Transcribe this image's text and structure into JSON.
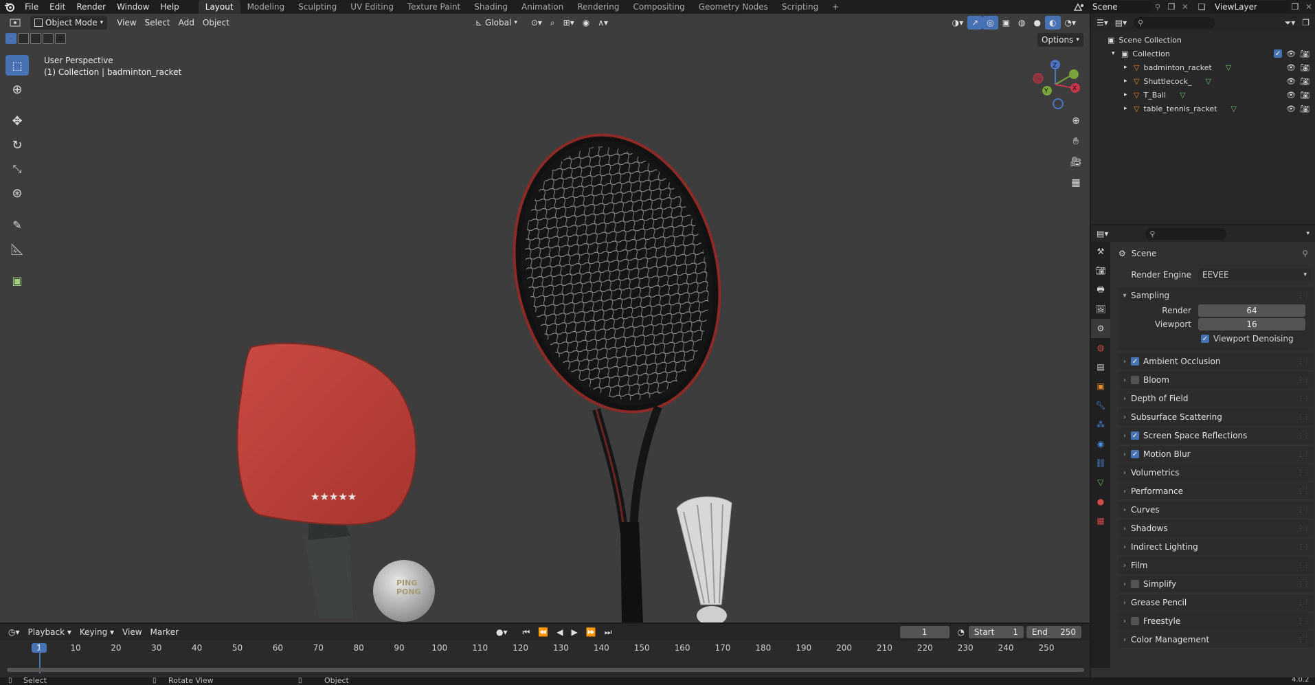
{
  "menubar": {
    "menus": [
      "File",
      "Edit",
      "Render",
      "Window",
      "Help"
    ],
    "workspaces": [
      "Layout",
      "Modeling",
      "Sculpting",
      "UV Editing",
      "Texture Paint",
      "Shading",
      "Animation",
      "Rendering",
      "Compositing",
      "Geometry Nodes",
      "Scripting"
    ],
    "active_workspace": "Layout",
    "add_workspace": "+",
    "scene": "Scene",
    "view_layer": "ViewLayer"
  },
  "viewport": {
    "mode": "Object Mode",
    "menus": [
      "View",
      "Select",
      "Add",
      "Object"
    ],
    "orientation": "Global",
    "options": "Options",
    "perspective": "User Perspective",
    "collection_info": "(1) Collection | badminton_racket",
    "gizmo_axes": {
      "x": "X",
      "y": "Y",
      "z": "Z"
    },
    "ball_text": [
      "PING",
      "PONG"
    ],
    "tools": [
      "select-box-icon",
      "cursor-icon",
      "move-icon",
      "rotate-icon",
      "scale-icon",
      "transform-icon",
      "annotate-icon",
      "measure-icon",
      "add-cube-icon"
    ],
    "nav": [
      "zoom-icon",
      "pan-icon",
      "camera-icon",
      "grid-icon"
    ]
  },
  "timeline": {
    "menus": [
      "Playback",
      "Keying",
      "View",
      "Marker"
    ],
    "current_frame": "1",
    "start_label": "Start",
    "start": "1",
    "end_label": "End",
    "end": "250",
    "ticks": [
      "1",
      "10",
      "20",
      "30",
      "40",
      "50",
      "60",
      "70",
      "80",
      "90",
      "100",
      "110",
      "120",
      "130",
      "140",
      "150",
      "160",
      "170",
      "180",
      "190",
      "200",
      "210",
      "220",
      "230",
      "240",
      "250"
    ]
  },
  "statusbar": {
    "items": [
      "Select",
      "Rotate View",
      "Object"
    ],
    "version": "4.0.2"
  },
  "outliner": {
    "root": "Scene Collection",
    "collection": "Collection",
    "objects": [
      "badminton_racket",
      "Shuttlecock_",
      "T_Ball",
      "table_tennis_racket"
    ]
  },
  "properties": {
    "context": "Scene",
    "render_engine_label": "Render Engine",
    "render_engine": "EEVEE",
    "sampling": {
      "title": "Sampling",
      "render_label": "Render",
      "render": "64",
      "viewport_label": "Viewport",
      "viewport": "16",
      "denoise_label": "Viewport Denoising",
      "denoise": true
    },
    "panels": [
      {
        "label": "Ambient Occlusion",
        "checkbox": true,
        "checked": true
      },
      {
        "label": "Bloom",
        "checkbox": true,
        "checked": false
      },
      {
        "label": "Depth of Field",
        "checkbox": false
      },
      {
        "label": "Subsurface Scattering",
        "checkbox": false
      },
      {
        "label": "Screen Space Reflections",
        "checkbox": true,
        "checked": true
      },
      {
        "label": "Motion Blur",
        "checkbox": true,
        "checked": true
      },
      {
        "label": "Volumetrics",
        "checkbox": false
      },
      {
        "label": "Performance",
        "checkbox": false
      },
      {
        "label": "Curves",
        "checkbox": false
      },
      {
        "label": "Shadows",
        "checkbox": false
      },
      {
        "label": "Indirect Lighting",
        "checkbox": false
      },
      {
        "label": "Film",
        "checkbox": false
      },
      {
        "label": "Simplify",
        "checkbox": true,
        "checked": false
      },
      {
        "label": "Grease Pencil",
        "checkbox": false
      },
      {
        "label": "Freestyle",
        "checkbox": true,
        "checked": false
      },
      {
        "label": "Color Management",
        "checkbox": false
      }
    ]
  },
  "colors": {
    "accent": "#4772b3",
    "viewport_bg": "#3d3d3d",
    "paddle_red": "#c0423a",
    "frame_marker": "#4772b3"
  }
}
